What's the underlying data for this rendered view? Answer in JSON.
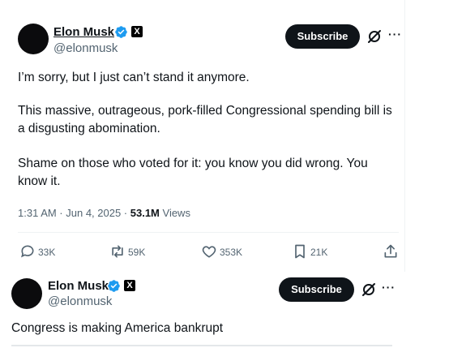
{
  "tweet1": {
    "author_name": "Elon Musk",
    "author_handle": "@elonmusk",
    "subscribe_label": "Subscribe",
    "more_label": "···",
    "paragraphs": [
      "I’m sorry, but I just can’t stand it anymore.",
      "This massive, outrageous, pork-filled Congressional spending bill is a disgusting abomination.",
      "Shame on those who voted for it: you know you did wrong. You know it."
    ],
    "timestamp": "1:31 AM · Jun 4, 2025 · ",
    "views_count": "53.1M",
    "views_label": " Views",
    "actions": {
      "replies": "33K",
      "reposts": "59K",
      "likes": "353K",
      "bookmarks": "21K"
    }
  },
  "tweet2": {
    "author_name": "Elon Musk",
    "author_handle": "@elonmusk",
    "subscribe_label": "Subscribe",
    "more_label": "···",
    "text": "Congress is making America bankrupt"
  },
  "colors": {
    "verified_blue": "#1d9bf0",
    "text_primary": "#0f1419",
    "text_secondary": "#536471",
    "button_dark": "#0f1419"
  },
  "icons": [
    "verified-icon",
    "x-logo-icon",
    "grok-icon",
    "more-icon",
    "reply-icon",
    "repost-icon",
    "like-icon",
    "bookmark-icon",
    "share-icon"
  ]
}
